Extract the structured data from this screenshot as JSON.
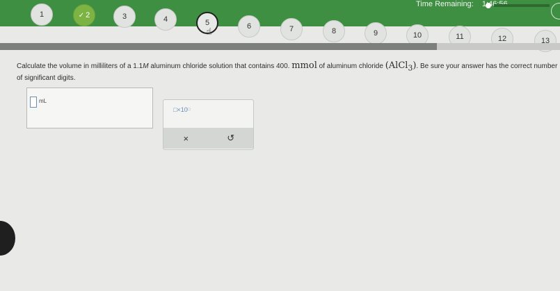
{
  "timer": {
    "label": "Time Remaining:",
    "value": "1:46:56"
  },
  "question_nav": [
    {
      "label": "1",
      "state": "normal"
    },
    {
      "label": "2",
      "state": "done"
    },
    {
      "label": "3",
      "state": "normal"
    },
    {
      "label": "4",
      "state": "normal"
    },
    {
      "label": "5",
      "state": "current"
    },
    {
      "label": "6",
      "state": "normal"
    },
    {
      "label": "7",
      "state": "normal"
    },
    {
      "label": "8",
      "state": "normal"
    },
    {
      "label": "9",
      "state": "normal"
    },
    {
      "label": "10",
      "state": "normal"
    },
    {
      "label": "11",
      "state": "normal"
    },
    {
      "label": "12",
      "state": "normal"
    },
    {
      "label": "13",
      "state": "normal"
    }
  ],
  "progress": {
    "fraction": 0.78
  },
  "question": {
    "text_before": "Calculate the volume in milliliters of a 1.1",
    "unit_molarity": "M",
    "text_middle": " aluminum chloride solution that contains 400. ",
    "unit_mmol": "mmol",
    "text_after_mmol": " of aluminum chloride ",
    "formula_open": "(AlCl",
    "formula_sub": "3",
    "formula_close": ")",
    "text_end": ". Be sure your answer has the correct number of significant digits."
  },
  "answer": {
    "value": "",
    "unit": "mL"
  },
  "tools": {
    "sci_notation_label": "□×10",
    "sci_notation_exp": "□",
    "clear_label": "×",
    "undo_label": "↺"
  },
  "colors": {
    "topbar": "#3f8f43",
    "done": "#7cb342",
    "progress_fill": "#7d7f7c",
    "input_border": "#6a8fb7"
  },
  "icons": {
    "check": "check-icon",
    "cursor": "hand-cursor-icon",
    "clear": "x-icon",
    "undo": "undo-icon"
  }
}
